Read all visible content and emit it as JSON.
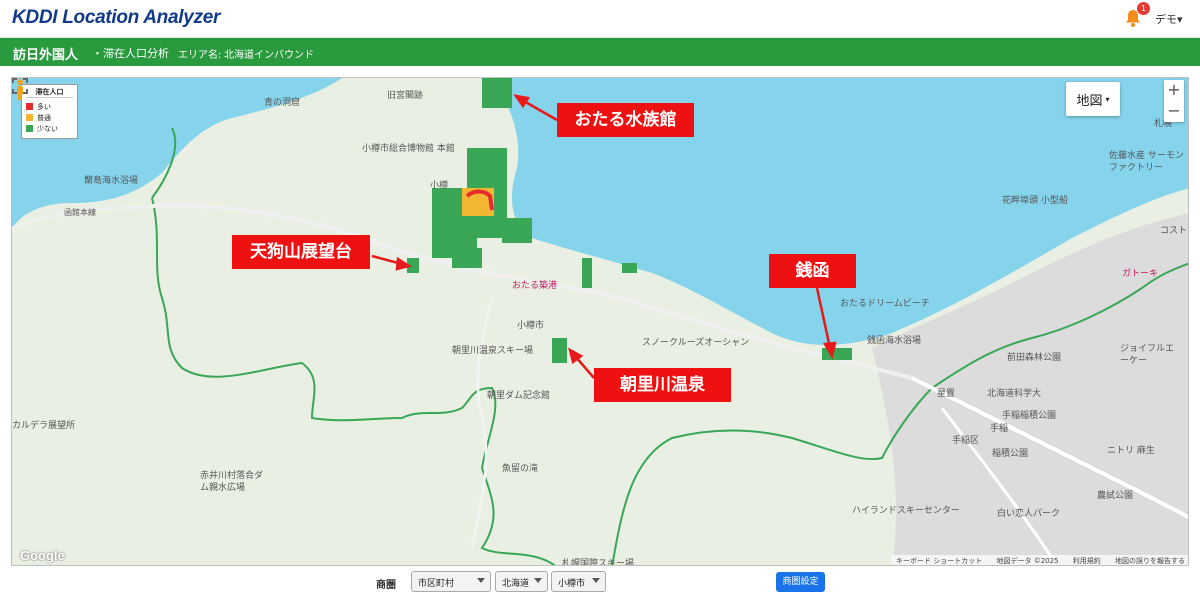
{
  "header": {
    "app_title": "KDDI Location Analyzer",
    "notification_count": "1",
    "user_menu": "デモ▾"
  },
  "subheader": {
    "title": "訪日外国人",
    "subtitle": "・滞在人口分析",
    "area_label": "エリア名:",
    "area_value": "北海道インバウンド"
  },
  "legend": {
    "title": "滞在人口",
    "items": [
      {
        "label": "多い",
        "color": "#e52b2b"
      },
      {
        "label": "普通",
        "color": "#f2b632"
      },
      {
        "label": "少ない",
        "color": "#3aa757"
      }
    ]
  },
  "map": {
    "type_button": "地図",
    "google": "Google",
    "attribution": [
      "キーボード ショートカット",
      "地図データ ©2025",
      "利用規約",
      "地図の誤りを報告する"
    ],
    "place_labels": [
      "青の洞窟",
      "旧宮閣跡",
      "小樽市総合博物館 本館",
      "蘭島海水浴場",
      "函館本線",
      "小樽",
      "おたる水族館",
      "おたる築港",
      "小樽市",
      "朝里川温泉スキー場",
      "朝里ダム記念館",
      "スノークルーズオーシャン",
      "おたるドリームビーチ",
      "銭函海水浴場",
      "銭函",
      "星置",
      "北海道科学大",
      "前田森林公園",
      "手稲稲積公園",
      "手稲",
      "手稲区",
      "稲積公園",
      "ハイランドスキーセンター",
      "白い恋人パーク",
      "農試公園",
      "ニトリ 麻生",
      "魚留の滝",
      "赤井川村落合ダム親水広場",
      "カルデラ展望所",
      "札幌国際スキー場",
      "花畔埠頭 小型船",
      "佐藤水産 サーモンファクトリー",
      "ジョイフルエーケー",
      "ガトーキ",
      "コストコ",
      "札幌"
    ]
  },
  "callouts": [
    {
      "label": "おたる水族館"
    },
    {
      "label": "天狗山展望台"
    },
    {
      "label": "銭函"
    },
    {
      "label": "朝里川温泉"
    }
  ],
  "filters": {
    "label": "商圏",
    "level": "市区町村",
    "prefecture": "北海道",
    "city": "小樽市",
    "button": "商圏設定"
  },
  "colors": {
    "brand_green": "#2a9a3f",
    "sea": "#86d3ec",
    "land": "#e9f0e3",
    "callout_red": "#ee1111",
    "button_blue": "#1a73e8"
  }
}
